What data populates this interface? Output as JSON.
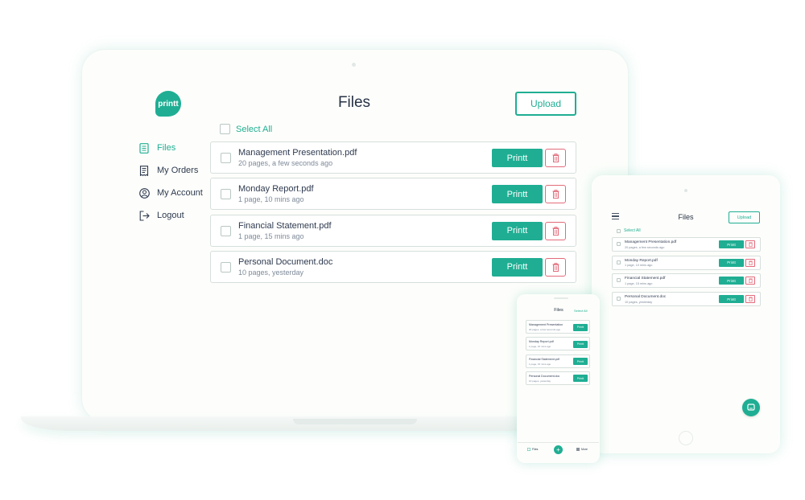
{
  "brand": {
    "logo_text": "printt",
    "accent": "#1fae93",
    "danger": "#e26b7a"
  },
  "laptop": {
    "title": "Files",
    "upload_label": "Upload",
    "select_all_label": "Select All",
    "nav": [
      {
        "label": "Files",
        "icon": "file-list-icon",
        "active": true
      },
      {
        "label": "My Orders",
        "icon": "orders-icon",
        "active": false
      },
      {
        "label": "My Account",
        "icon": "account-icon",
        "active": false
      },
      {
        "label": "Logout",
        "icon": "logout-icon",
        "active": false
      }
    ],
    "print_label": "Printt",
    "files": [
      {
        "name": "Management Presentation.pdf",
        "meta": "20 pages, a few seconds ago"
      },
      {
        "name": "Monday Report.pdf",
        "meta": "1 page, 10 mins ago"
      },
      {
        "name": "Financial Statement.pdf",
        "meta": "1 page, 15 mins ago"
      },
      {
        "name": "Personal Document.doc",
        "meta": "10 pages, yesterday"
      }
    ]
  },
  "tablet": {
    "title": "Files",
    "upload_label": "Upload",
    "select_all_label": "Select All",
    "print_label": "Printt",
    "files": [
      {
        "name": "Management Presentation.pdf",
        "meta": "20 pages, a few seconds ago"
      },
      {
        "name": "Monday Report.pdf",
        "meta": "1 page, 10 mins ago"
      },
      {
        "name": "Financial Statement.pdf",
        "meta": "1 page, 15 mins ago"
      },
      {
        "name": "Personal Document.doc",
        "meta": "10 pages, yesterday"
      }
    ]
  },
  "phone": {
    "title": "Files",
    "select_all_label": "Select All",
    "print_label": "Printt",
    "files": [
      {
        "name": "Management Presentation",
        "meta": "20 pages, a few seconds ago"
      },
      {
        "name": "Monday Report.pdf",
        "meta": "1 page, 10 mins ago"
      },
      {
        "name": "Financial Statement.pdf",
        "meta": "1 page, 15 mins ago"
      },
      {
        "name": "Personal Document.doc",
        "meta": "10 pages, yesterday"
      }
    ],
    "tabbar": {
      "files_label": "Files",
      "add_label": "+",
      "more_label": "More"
    }
  }
}
